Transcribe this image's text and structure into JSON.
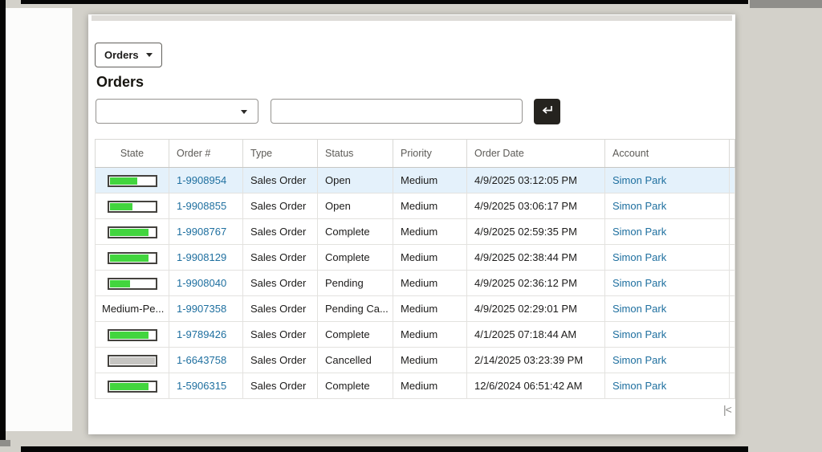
{
  "toolbar": {
    "orders_menu_label": "Orders"
  },
  "page": {
    "title": "Orders"
  },
  "filters": {
    "select_value": "",
    "search_value": "",
    "enter_icon": "return-arrow"
  },
  "pagination": {
    "first_label": "|<"
  },
  "colors": {
    "link": "#1e6f9f",
    "meter_green": "#42d53e",
    "meter_gray": "#c6c5c2",
    "row_highlight": "#e4f1fb"
  },
  "table": {
    "columns": [
      "State",
      "Order #",
      "Type",
      "Status",
      "Priority",
      "Order Date",
      "Account"
    ],
    "rows": [
      {
        "state": {
          "kind": "meter",
          "percent": 62,
          "variant": "green"
        },
        "order_num": "1-9908954",
        "type": "Sales Order",
        "status": "Open",
        "priority": "Medium",
        "order_date": "4/9/2025 03:12:05 PM",
        "account": "Simon Park",
        "highlight": true
      },
      {
        "state": {
          "kind": "meter",
          "percent": 50,
          "variant": "green"
        },
        "order_num": "1-9908855",
        "type": "Sales Order",
        "status": "Open",
        "priority": "Medium",
        "order_date": "4/9/2025 03:06:17 PM",
        "account": "Simon Park",
        "highlight": false
      },
      {
        "state": {
          "kind": "meter",
          "percent": 87,
          "variant": "green"
        },
        "order_num": "1-9908767",
        "type": "Sales Order",
        "status": "Complete",
        "priority": "Medium",
        "order_date": "4/9/2025 02:59:35 PM",
        "account": "Simon Park",
        "highlight": false
      },
      {
        "state": {
          "kind": "meter",
          "percent": 87,
          "variant": "green"
        },
        "order_num": "1-9908129",
        "type": "Sales Order",
        "status": "Complete",
        "priority": "Medium",
        "order_date": "4/9/2025 02:38:44 PM",
        "account": "Simon Park",
        "highlight": false
      },
      {
        "state": {
          "kind": "meter",
          "percent": 45,
          "variant": "green"
        },
        "order_num": "1-9908040",
        "type": "Sales Order",
        "status": "Pending",
        "priority": "Medium",
        "order_date": "4/9/2025 02:36:12 PM",
        "account": "Simon Park",
        "highlight": false
      },
      {
        "state": {
          "kind": "text",
          "text": "Medium-Pe..."
        },
        "order_num": "1-9907358",
        "type": "Sales Order",
        "status": "Pending Ca...",
        "priority": "Medium",
        "order_date": "4/9/2025 02:29:01 PM",
        "account": "Simon Park",
        "highlight": false
      },
      {
        "state": {
          "kind": "meter",
          "percent": 87,
          "variant": "green"
        },
        "order_num": "1-9789426",
        "type": "Sales Order",
        "status": "Complete",
        "priority": "Medium",
        "order_date": "4/1/2025 07:18:44 AM",
        "account": "Simon Park",
        "highlight": false
      },
      {
        "state": {
          "kind": "meter",
          "percent": 100,
          "variant": "gray"
        },
        "order_num": "1-6643758",
        "type": "Sales Order",
        "status": "Cancelled",
        "priority": "Medium",
        "order_date": "2/14/2025 03:23:39 PM",
        "account": "Simon Park",
        "highlight": false
      },
      {
        "state": {
          "kind": "meter",
          "percent": 87,
          "variant": "green"
        },
        "order_num": "1-5906315",
        "type": "Sales Order",
        "status": "Complete",
        "priority": "Medium",
        "order_date": "12/6/2024 06:51:42 AM",
        "account": "Simon Park",
        "highlight": false
      }
    ]
  }
}
